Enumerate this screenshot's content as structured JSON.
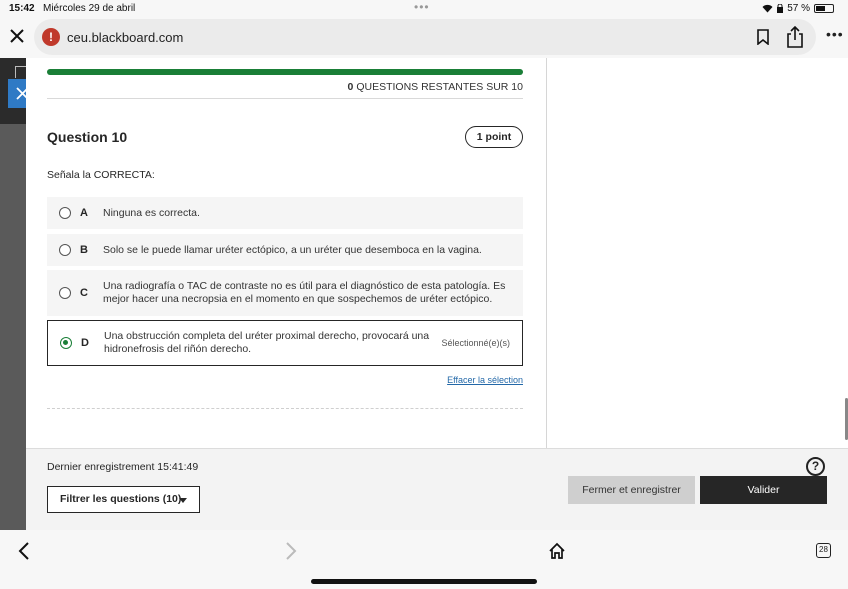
{
  "status_bar": {
    "time": "15:42",
    "date": "Miércoles 29 de abril",
    "battery": "57 %",
    "battery_level": 0.57
  },
  "browser": {
    "url": "ceu.blackboard.com"
  },
  "quiz": {
    "progress": 1.0,
    "remaining_count": "0",
    "remaining_text": "QUESTIONS RESTANTES SUR 10",
    "question_title": "Question 10",
    "points": "1 point",
    "prompt": "Señala la CORRECTA:",
    "options": [
      {
        "letter": "A",
        "text": "Ninguna es correcta."
      },
      {
        "letter": "B",
        "text": "Solo se le puede llamar uréter ectópico, a un uréter que desemboca en la vagina."
      },
      {
        "letter": "C",
        "text": "Una radiografía o TAC de contraste no es útil para el diagnóstico de esta patología. Es mejor hacer una necropsia en el momento en que sospechemos de uréter ectópico."
      },
      {
        "letter": "D",
        "text": "Una obstrucción completa del uréter proximal derecho, provocará una hidronefrosis del riñón derecho.",
        "selected_label": "Sélectionné(e)(s)"
      }
    ],
    "selected_option": "D",
    "clear_selection": "Effacer la sélection"
  },
  "footer": {
    "last_saved": "Dernier enregistrement 15:41:49",
    "filter_label": "Filtrer les questions (10)",
    "close_save_label": "Fermer et enregistrer",
    "validate_label": "Valider"
  },
  "bottom_bar": {
    "tabs_count": "28"
  }
}
